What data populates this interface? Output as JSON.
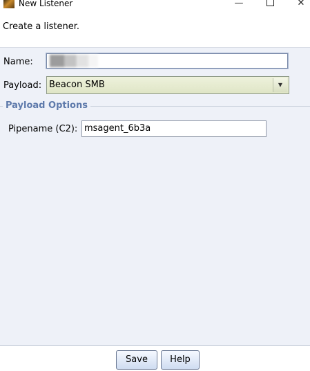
{
  "window": {
    "title": "New Listener",
    "minimize_glyph": "—",
    "close_glyph": "✕"
  },
  "description": "Create a listener.",
  "form": {
    "name_label": "Name:",
    "name_value": "",
    "payload_label": "Payload:",
    "payload_value": "Beacon SMB"
  },
  "payload_options": {
    "title": "Payload Options",
    "pipename_label": "Pipename (C2):",
    "pipename_value": "msagent_6b3a"
  },
  "buttons": {
    "save": "Save",
    "help": "Help"
  },
  "icons": {
    "app": "app-icon",
    "dropdown": "chevron-down-icon"
  }
}
